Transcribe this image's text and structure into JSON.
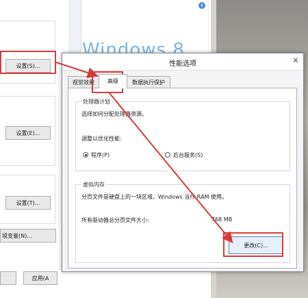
{
  "background_window": {
    "settings_btn_1": "设置(S)...",
    "settings_btn_2": "设置(E)...",
    "settings_btn_3": "设置(T)...",
    "env_vars_btn": "境变量(N)...",
    "apply_btn": "应用(A",
    "info_badge": "i",
    "watermark": "Windows 8"
  },
  "dialog": {
    "title": "性能选项",
    "close": "✕",
    "tabs": [
      {
        "label": "视觉效果"
      },
      {
        "label": "高级"
      },
      {
        "label": "数据执行保护"
      }
    ],
    "processor": {
      "title": "处理器计划",
      "desc": "选择如何分配处理器资源。",
      "adjust_label": "调整以优化性能:",
      "option_programs": "程序(P)",
      "option_services": "后台服务(S)"
    },
    "virtual_memory": {
      "title": "虚拟内存",
      "desc": "分页文件是硬盘上的一块区域，Windows 当作 RAM 使用。",
      "total_label": "所有驱动器总分页文件大小:",
      "total_value": "768 MB",
      "change_btn": "更改(C)..."
    }
  },
  "colors": {
    "highlight_red": "#d83a3a",
    "accent_blue": "#4a8fe0"
  }
}
